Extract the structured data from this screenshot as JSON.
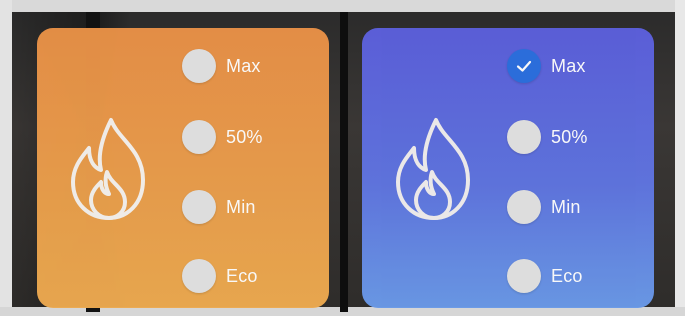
{
  "panels": [
    {
      "state": "unselected",
      "icon": "flame-icon",
      "color": "#EA9A4A",
      "options": [
        {
          "label": "Max",
          "checked": false
        },
        {
          "label": "50%",
          "checked": false
        },
        {
          "label": "Min",
          "checked": false
        },
        {
          "label": "Eco",
          "checked": false
        }
      ]
    },
    {
      "state": "selected",
      "icon": "flame-icon",
      "color": "#5F78E0",
      "options": [
        {
          "label": "Max",
          "checked": true
        },
        {
          "label": "50%",
          "checked": false
        },
        {
          "label": "Min",
          "checked": false
        },
        {
          "label": "Eco",
          "checked": false
        }
      ]
    }
  ],
  "colors": {
    "radio_checked": "#2B6FE0",
    "radio_unchecked": "#E3E3E3"
  }
}
